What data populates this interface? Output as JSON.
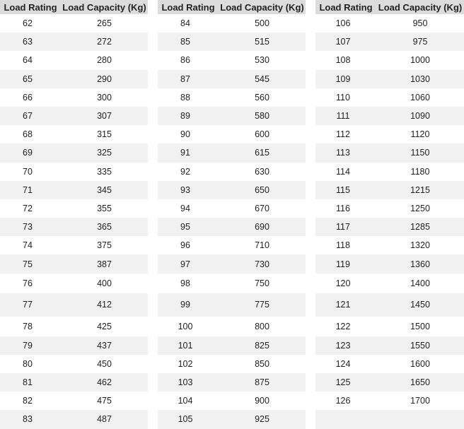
{
  "headers": {
    "rating": "Load Rating",
    "capacity": "Load Capacity (Kg)"
  },
  "tables": [
    {
      "rows": [
        [
          "62",
          "265"
        ],
        [
          "63",
          "272"
        ],
        [
          "64",
          "280"
        ],
        [
          "65",
          "290"
        ],
        [
          "66",
          "300"
        ],
        [
          "67",
          "307"
        ],
        [
          "68",
          "315"
        ],
        [
          "69",
          "325"
        ],
        [
          "70",
          "335"
        ],
        [
          "71",
          "345"
        ],
        [
          "72",
          "355"
        ],
        [
          "73",
          "365"
        ],
        [
          "74",
          "375"
        ],
        [
          "75",
          "387"
        ],
        [
          "76",
          "400"
        ],
        [
          "77",
          "412"
        ],
        [
          "78",
          "425"
        ],
        [
          "79",
          "437"
        ],
        [
          "80",
          "450"
        ],
        [
          "81",
          "462"
        ],
        [
          "82",
          "475"
        ],
        [
          "83",
          "487"
        ]
      ]
    },
    {
      "rows": [
        [
          "84",
          "500"
        ],
        [
          "85",
          "515"
        ],
        [
          "86",
          "530"
        ],
        [
          "87",
          "545"
        ],
        [
          "88",
          "560"
        ],
        [
          "89",
          "580"
        ],
        [
          "90",
          "600"
        ],
        [
          "91",
          "615"
        ],
        [
          "92",
          "630"
        ],
        [
          "93",
          "650"
        ],
        [
          "94",
          "670"
        ],
        [
          "95",
          "690"
        ],
        [
          "96",
          "710"
        ],
        [
          "97",
          "730"
        ],
        [
          "98",
          "750"
        ],
        [
          "99",
          "775"
        ],
        [
          "100",
          "800"
        ],
        [
          "101",
          "825"
        ],
        [
          "102",
          "850"
        ],
        [
          "103",
          "875"
        ],
        [
          "104",
          "900"
        ],
        [
          "105",
          "925"
        ]
      ]
    },
    {
      "rows": [
        [
          "106",
          "950"
        ],
        [
          "107",
          "975"
        ],
        [
          "108",
          "1000"
        ],
        [
          "109",
          "1030"
        ],
        [
          "110",
          "1060"
        ],
        [
          "111",
          "1090"
        ],
        [
          "112",
          "1120"
        ],
        [
          "113",
          "1150"
        ],
        [
          "114",
          "1180"
        ],
        [
          "115",
          "1215"
        ],
        [
          "116",
          "1250"
        ],
        [
          "117",
          "1285"
        ],
        [
          "118",
          "1320"
        ],
        [
          "119",
          "1360"
        ],
        [
          "120",
          "1400"
        ],
        [
          "121",
          "1450"
        ],
        [
          "122",
          "1500"
        ],
        [
          "123",
          "1550"
        ],
        [
          "124",
          "1600"
        ],
        [
          "125",
          "1650"
        ],
        [
          "126",
          "1700"
        ],
        [
          "",
          ""
        ]
      ]
    }
  ]
}
